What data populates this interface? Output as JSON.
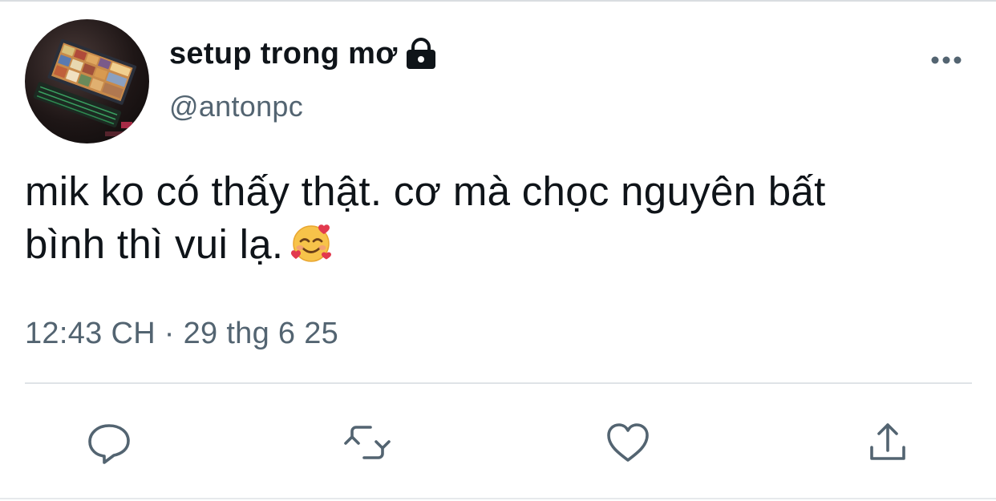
{
  "tweet": {
    "author": {
      "display_name": "setup trong mơ",
      "handle": "@antonpc",
      "protected": true
    },
    "text_line1": "mik ko có thấy thật. cơ mà chọc nguyên bất",
    "text_line2": "bình thì vui lạ.",
    "emoji": "smiling-face-with-hearts",
    "timestamp": "12:43 CH · 29 thg 6 25"
  },
  "actions": [
    "reply-icon",
    "retweet-icon",
    "like-icon",
    "share-icon"
  ],
  "colors": {
    "text": "#0f1419",
    "secondary": "#536471",
    "divider": "#dfe3e7"
  }
}
